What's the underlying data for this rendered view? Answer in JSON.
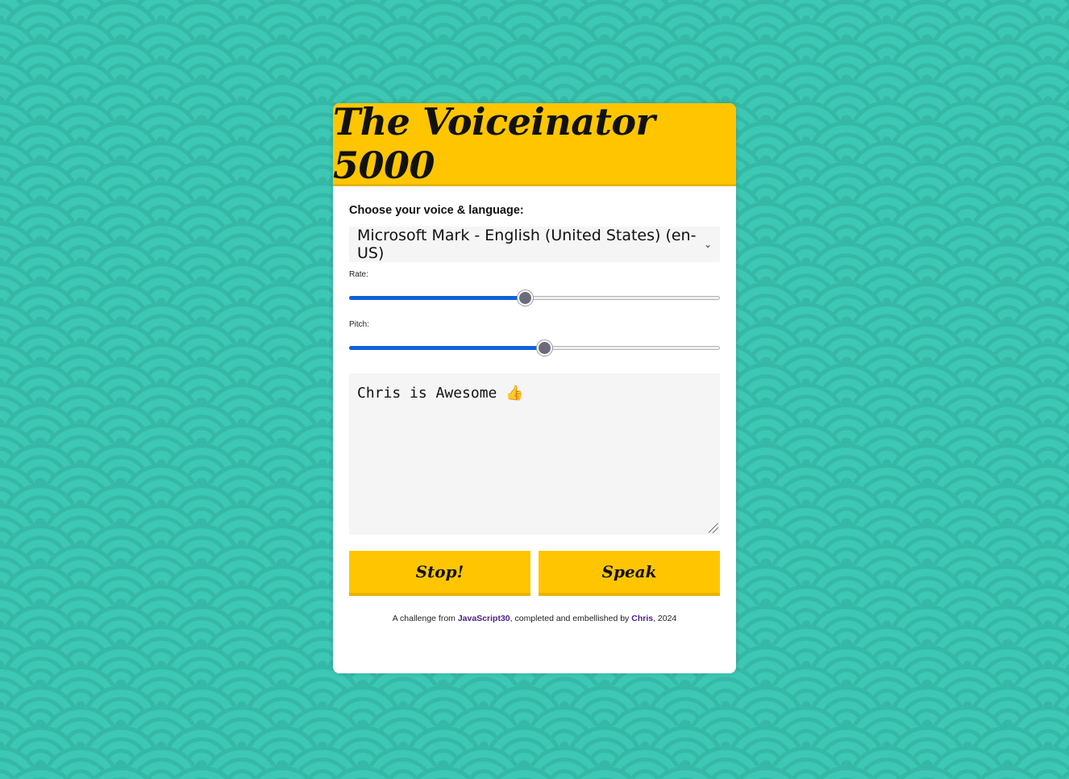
{
  "header": {
    "title": "The Voiceinator 5000"
  },
  "voice": {
    "label": "Choose your voice & language:",
    "selected": "Microsoft Mark - English (United States) (en-US)"
  },
  "rate": {
    "label": "Rate:",
    "value_fraction": 0.474
  },
  "pitch": {
    "label": "Pitch:",
    "value_fraction": 0.526
  },
  "message": {
    "text": "Chris is Awesome 👍"
  },
  "buttons": {
    "stop": "Stop!",
    "speak": "Speak"
  },
  "footer": {
    "prefix": "A challenge from ",
    "link1": "JavaScript30",
    "middle": ", completed and embellished by ",
    "link2": "Chris",
    "suffix": ", 2024"
  },
  "colors": {
    "accent": "#ffc600",
    "background": "#3cc8b4",
    "slider_fill": "#0f62d9",
    "link": "#4b1f8a"
  }
}
